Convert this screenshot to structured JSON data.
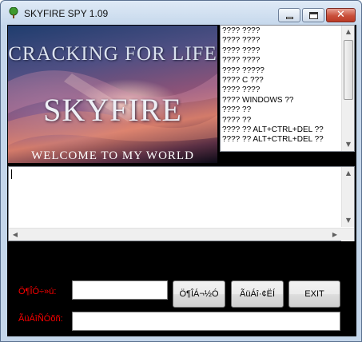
{
  "window": {
    "title": "SKYFIRE SPY 1.09",
    "icon": "tree-icon",
    "controls": {
      "minimize": "minimize-icon",
      "maximize": "maximize-icon",
      "close": "close-icon"
    }
  },
  "banner": {
    "line1": "CRACKING FOR LIFE",
    "line2": "SKYFIRE",
    "line3": "WELCOME TO MY WORLD"
  },
  "log": {
    "items": [
      "???? ????",
      "???? ????",
      "???? ????",
      "???? ????",
      "???? ?????",
      "???? C ???",
      "???? ????",
      "???? WINDOWS ??",
      "???? ??",
      "???? ??",
      "???? ?? ALT+CTRL+DEL ??",
      "???? ?? ALT+CTRL+DEL ??"
    ]
  },
  "editor": {
    "value": ""
  },
  "form": {
    "label1": "Ö¶ÎÓ÷»ú:",
    "label2": "ÃüÁîÑÓõñ:",
    "field1_value": "",
    "field2_value": "",
    "button1": "Ö¶ÎÁ¬½Ó",
    "button2": "ÃüÁî·¢ËÍ",
    "button3": "EXIT"
  },
  "colors": {
    "client_bg": "#000000",
    "label_color": "#ff0000",
    "titlebar": "#c6d8ec",
    "close_button": "#c9503b"
  }
}
